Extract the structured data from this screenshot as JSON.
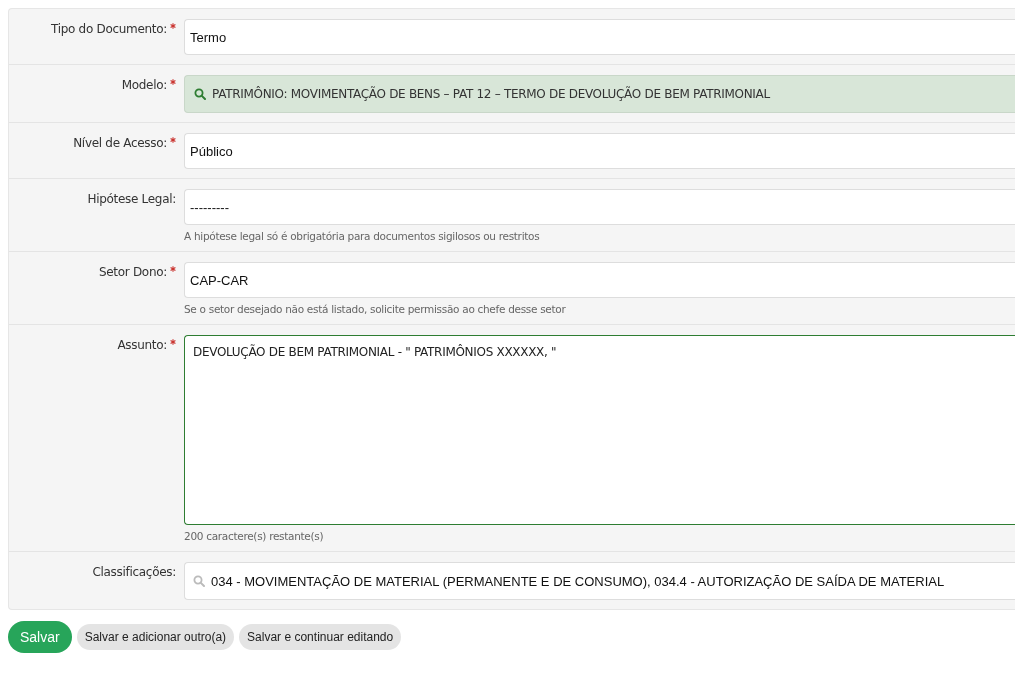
{
  "fields": [
    {
      "label": "Tipo do Documento:",
      "required": true,
      "kind": "select",
      "value": "Termo"
    },
    {
      "label": "Modelo:",
      "required": true,
      "kind": "chosen",
      "value": "PATRIMÔNIO: MOVIMENTAÇÃO DE BENS – PAT 12 – TERMO DE DEVOLUÇÃO DE BEM PATRIMONIAL"
    },
    {
      "label": "Nível de Acesso:",
      "required": true,
      "kind": "select",
      "value": "Público"
    },
    {
      "label": "Hipótese Legal:",
      "required": false,
      "kind": "select",
      "value": "---------",
      "help": "A hipótese legal só é obrigatória para documentos sigilosos ou restritos"
    },
    {
      "label": "Setor Dono:",
      "required": true,
      "kind": "select",
      "value": "CAP-CAR",
      "help": "Se o setor desejado não está listado, solicite permissão ao chefe desse setor"
    },
    {
      "label": "Assunto:",
      "required": true,
      "kind": "textarea",
      "value": "DEVOLUÇÃO DE BEM PATRIMONIAL  - \" PATRIMÔNIOS XXXXXX, \"",
      "help": "200 caractere(s) restante(s)"
    },
    {
      "label": "Classificações:",
      "required": false,
      "kind": "search",
      "value": "034 - MOVIMENTAÇÃO DE MATERIAL (PERMANENTE E DE CONSUMO), 034.4 - AUTORIZAÇÃO DE SAÍDA DE MATERIAL"
    }
  ],
  "buttons": [
    {
      "label": "Salvar",
      "primary": true
    },
    {
      "label": "Salvar e adicionar outro(a)",
      "primary": false
    },
    {
      "label": "Salvar e continuar editando",
      "primary": false
    }
  ]
}
